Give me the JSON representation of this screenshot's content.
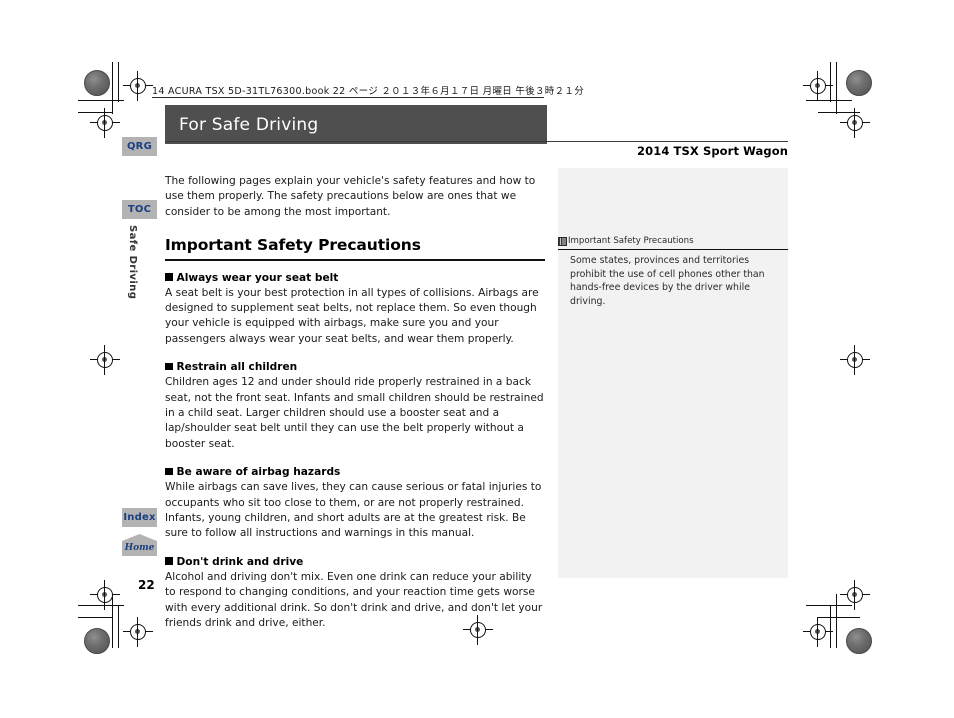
{
  "print_info": {
    "line": "14 ACURA TSX 5D-31TL76300.book   22 ページ   ２０１３年６月１７日   月曜日   午後３時２１分"
  },
  "header": {
    "title": "For Safe Driving",
    "model": "2014 TSX Sport Wagon"
  },
  "sidebar": {
    "tabs": [
      {
        "label": "QRG"
      },
      {
        "label": "TOC"
      },
      {
        "label": "Index"
      },
      {
        "label": "Home"
      }
    ],
    "chapter_label": "Safe Driving"
  },
  "main": {
    "intro": "The following pages explain your vehicle's safety features and how to use them properly. The safety precautions below are ones that we consider to be among the most important.",
    "section_title": "Important Safety Precautions",
    "subsections": [
      {
        "heading": "Always wear your seat belt",
        "body": "A seat belt is your best protection in all types of collisions. Airbags are designed to supplement seat belts, not replace them. So even though your vehicle is equipped with airbags, make sure you and your passengers always wear your seat belts, and wear them properly."
      },
      {
        "heading": "Restrain all children",
        "body": "Children ages 12 and under should ride properly restrained in a back seat, not the front seat. Infants and small children should be restrained in a child seat. Larger children should use a booster seat and a lap/shoulder seat belt until they can use the belt properly without a booster seat."
      },
      {
        "heading": "Be aware of airbag hazards",
        "body": "While airbags can save lives, they can cause serious or fatal injuries to occupants who sit too close to them, or are not properly restrained. Infants, young children, and short adults are at the greatest risk. Be sure to follow all instructions and warnings in this manual."
      },
      {
        "heading": "Don't drink and drive",
        "body": "Alcohol and driving don't mix. Even one drink can reduce your ability to respond to changing conditions, and your reaction time gets worse with every additional drink. So don't drink and drive, and don't let your friends drink and drive, either."
      }
    ]
  },
  "note_panel": {
    "heading": "Important Safety Precautions",
    "body": "Some states, provinces and territories prohibit the use of cell phones other than hands-free devices by the driver while driving."
  },
  "footer": {
    "page_number": "22"
  },
  "colors": {
    "title_bar": "#4f4f4f",
    "tab_bg": "#b3b3b3",
    "tab_text": "#1b3f80",
    "note_bg": "#f2f2f2"
  }
}
